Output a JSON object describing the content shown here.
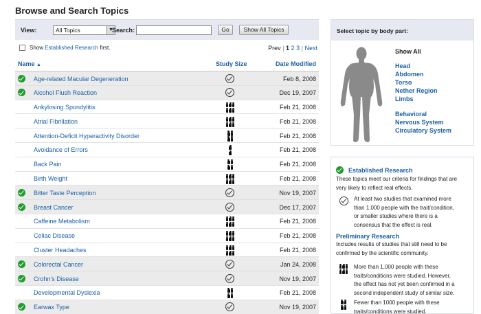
{
  "page_title": "Browse and Search Topics",
  "toolbar": {
    "view_label": "View:",
    "view_value": "All Topics",
    "search_label": "Search:",
    "search_value": "",
    "go_label": "Go",
    "show_all_label": "Show All Topics"
  },
  "filter": {
    "show_prefix": "Show",
    "show_link": "Established Research",
    "show_suffix": "first."
  },
  "pager": {
    "prev": "Prev",
    "sep1": "|",
    "page1": "1",
    "page2": "2",
    "page3": "3",
    "sep2": "|",
    "next": "Next"
  },
  "table": {
    "col_name": "Name",
    "col_size": "Study Size",
    "col_date": "Date Modified",
    "rows": [
      {
        "name": "Age-related Macular Degeneration",
        "established": true,
        "size": "check",
        "date": "Feb 8, 2008"
      },
      {
        "name": "Alcohol Flush Reaction",
        "established": true,
        "size": "check",
        "date": "Dec 19, 2007"
      },
      {
        "name": "Ankylosing Spondylitis",
        "established": false,
        "size": "3",
        "date": "Feb 21, 2008"
      },
      {
        "name": "Atrial Fibrillation",
        "established": false,
        "size": "3",
        "date": "Feb 21, 2008"
      },
      {
        "name": "Attention-Deficit Hyperactivity Disorder",
        "established": false,
        "size": "2",
        "date": "Feb 21, 2008"
      },
      {
        "name": "Avoidance of Errors",
        "established": false,
        "size": "1",
        "date": "Feb 21, 2008"
      },
      {
        "name": "Back Pain",
        "established": false,
        "size": "2",
        "date": "Feb 21, 2008"
      },
      {
        "name": "Birth Weight",
        "established": false,
        "size": "3",
        "date": "Feb 21, 2008"
      },
      {
        "name": "Bitter Taste Perception",
        "established": true,
        "size": "check",
        "date": "Nov 19, 2007"
      },
      {
        "name": "Breast Cancer",
        "established": true,
        "size": "check",
        "date": "Dec 17, 2007"
      },
      {
        "name": "Caffeine Metabolism",
        "established": false,
        "size": "3",
        "date": "Feb 21, 2008"
      },
      {
        "name": "Celiac Disease",
        "established": false,
        "size": "3",
        "date": "Feb 21, 2008"
      },
      {
        "name": "Cluster Headaches",
        "established": false,
        "size": "3",
        "date": "Feb 21, 2008"
      },
      {
        "name": "Colorectal Cancer",
        "established": true,
        "size": "check",
        "date": "Jan 24, 2008"
      },
      {
        "name": "Crohn's Disease",
        "established": true,
        "size": "check",
        "date": "Nov 19, 2007"
      },
      {
        "name": "Developmental Dyslexia",
        "established": false,
        "size": "2",
        "date": "Feb 21, 2008"
      },
      {
        "name": "Earwax Type",
        "established": true,
        "size": "check",
        "date": "Nov 19, 2007"
      }
    ]
  },
  "body_panel": {
    "header": "Select topic by body part:",
    "show_all": "Show All",
    "parts": [
      "Head",
      "Abdomen",
      "Torso",
      "Nether Region",
      "Limbs"
    ],
    "systems": [
      "Behavioral",
      "Nervous System",
      "Circulatory System"
    ]
  },
  "legend": {
    "established_title": "Established Research",
    "established_desc": [
      "These topics meet our criteria for findings that are",
      "very likely to reflect real effects."
    ],
    "check_desc": [
      "At least two studies that examined more",
      "than 1,000 people with the trait/condition,",
      "or smaller studies where there is a",
      "consensus that the effect is real."
    ],
    "preliminary_title": "Preliminary Research",
    "preliminary_desc": [
      "Includes results of studies that still need to be",
      "confirmed by the scientific community."
    ],
    "three_desc": [
      "More than 1,000 people with these",
      "traits/conditions were studied. However,",
      "the effect has not yet been confirmed in a",
      "second independent study of similar size."
    ],
    "two_desc": [
      "Fewer than 1000 people with these",
      "traits/conditions were studied."
    ]
  },
  "colors": {
    "link": "#1a5fa8",
    "established_green": "#1f9c2c",
    "header_bg": "#e6e9f2"
  }
}
